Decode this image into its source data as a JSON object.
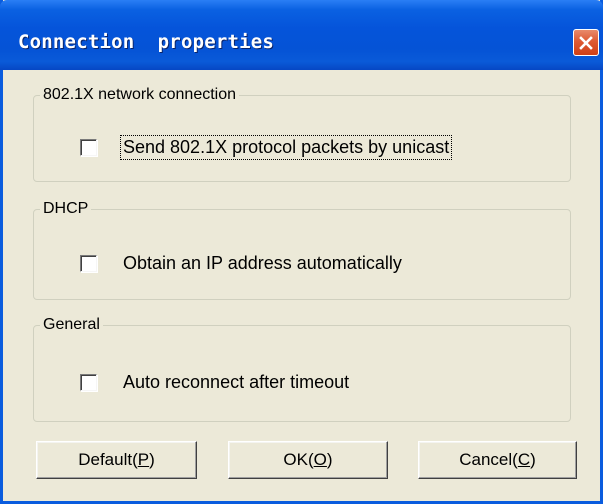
{
  "window": {
    "title": "Connection  properties",
    "close_icon": "close-x-icon"
  },
  "groups": [
    {
      "legend": "802.1X network connection",
      "checkbox_label": "Send 802.1X protocol packets by unicast",
      "checked": false,
      "focused": true
    },
    {
      "legend": "DHCP",
      "checkbox_label": "Obtain an IP address automatically",
      "checked": false,
      "focused": false
    },
    {
      "legend": "General",
      "checkbox_label": "Auto reconnect after timeout",
      "checked": false,
      "focused": false
    }
  ],
  "buttons": {
    "default": {
      "pre": "Default(",
      "acc": "P",
      "post": ")"
    },
    "ok": {
      "pre": "OK(",
      "acc": "O",
      "post": ")"
    },
    "cancel": {
      "pre": "Cancel(",
      "acc": "C",
      "post": ")"
    }
  },
  "colors": {
    "titlebar": "#0554da",
    "close_button": "#de5a34",
    "dialog_background": "#ece9d8"
  }
}
